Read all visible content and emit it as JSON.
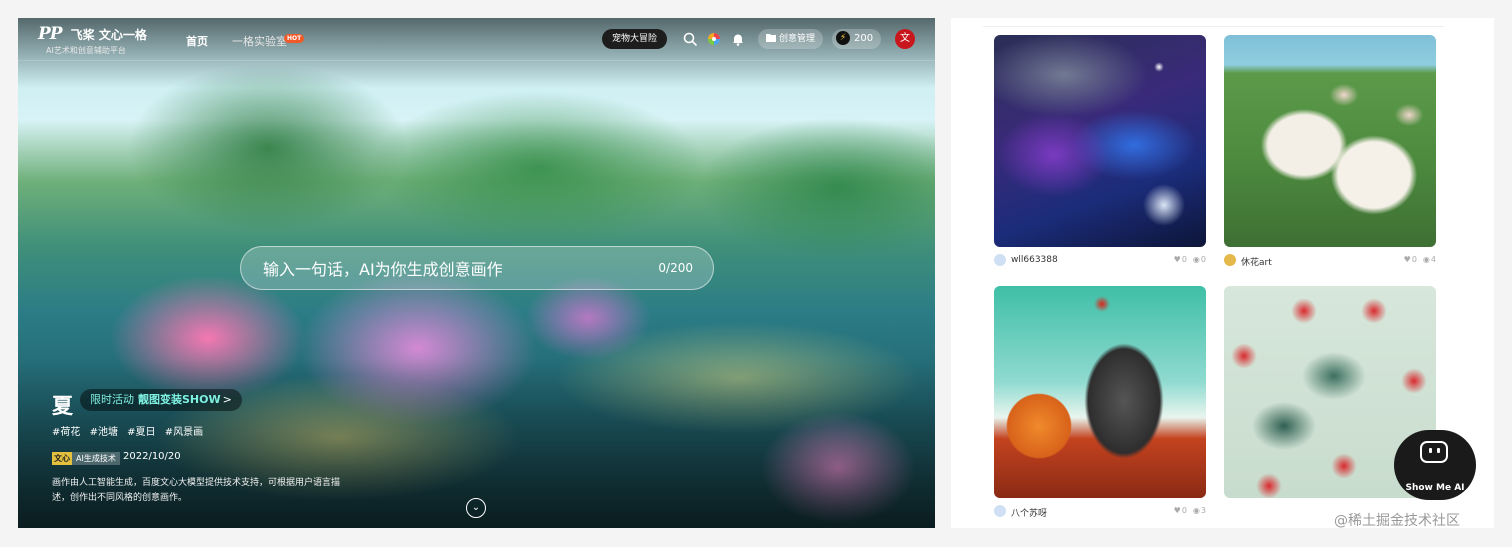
{
  "header": {
    "logo_mark": "PP",
    "brand": "飞桨 文心一格",
    "tagline": "AI艺术和创意辅助平台",
    "nav_home": "首页",
    "nav_lab": "一格实验室",
    "hot_badge": "HOT",
    "pet_adventure": "宠物大冒险",
    "creative_manage": "创意管理",
    "credits": "200",
    "avatar_char": "文"
  },
  "prompt": {
    "placeholder": "输入一句话，AI为你生成创意画作",
    "counter": "0/200"
  },
  "work": {
    "season": "夏",
    "event_label": "限时活动",
    "event_title": "靓图变装SHOW",
    "event_chevron": ">",
    "tags": [
      "#荷花",
      "#池塘",
      "#夏日",
      "#风景画"
    ],
    "badge_left": "文心",
    "badge_right": "AI生成技术",
    "date": "2022/10/20",
    "description": "画作由人工智能生成，百度文心大模型提供技术支持，可根据用户语言描述，创作出不同风格的创意画作。"
  },
  "gallery": {
    "cards": [
      {
        "user": "wll663388",
        "likes": "0",
        "views": "0",
        "avatar_color": "#cfe0f5"
      },
      {
        "user": "休花art",
        "likes": "0",
        "views": "4",
        "avatar_color": "#e4b84a"
      },
      {
        "user": "八个苏呀",
        "likes": "0",
        "views": "3",
        "avatar_color": "#cfe0f5"
      }
    ]
  },
  "widget": {
    "show_me_ai": "Show Me AI"
  },
  "watermark": "@稀土掘金技术社区",
  "colors": {
    "accent_event": "#7ff0e0",
    "hot": "#f05a28",
    "avatar_red": "#c8161d"
  }
}
